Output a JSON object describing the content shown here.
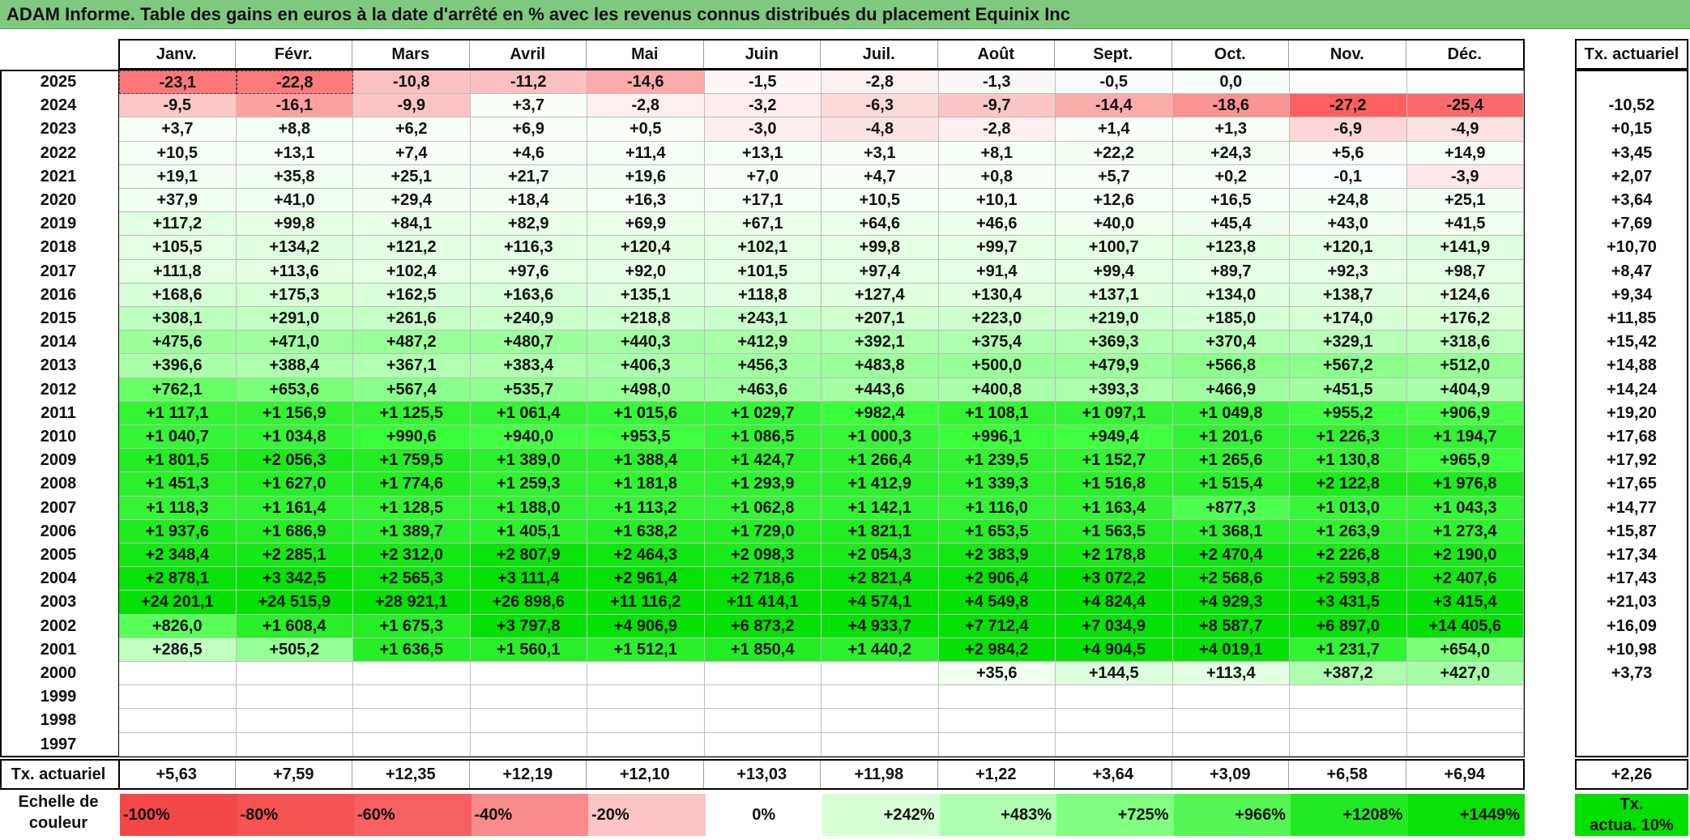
{
  "title": "ADAM Informe. Table des gains en euros à la date d'arrêté en % avec les revenus connus distribués du placement Equinix Inc",
  "months": [
    "Janv.",
    "Févr.",
    "Mars",
    "Avril",
    "Mai",
    "Juin",
    "Juil.",
    "Août",
    "Sept.",
    "Oct.",
    "Nov.",
    "Déc."
  ],
  "tx_header": "Tx. actuariel",
  "rows": [
    {
      "year": "2025",
      "values": [
        "-23,1",
        "-22,8",
        "-10,8",
        "-11,2",
        "-14,6",
        "-1,5",
        "-2,8",
        "-1,3",
        "-0,5",
        "0,0",
        "",
        ""
      ],
      "tx": ""
    },
    {
      "year": "2024",
      "values": [
        "-9,5",
        "-16,1",
        "-9,9",
        "+3,7",
        "-2,8",
        "-3,2",
        "-6,3",
        "-9,7",
        "-14,4",
        "-18,6",
        "-27,2",
        "-25,4"
      ],
      "tx": "-10,52"
    },
    {
      "year": "2023",
      "values": [
        "+3,7",
        "+8,8",
        "+6,2",
        "+6,9",
        "+0,5",
        "-3,0",
        "-4,8",
        "-2,8",
        "+1,4",
        "+1,3",
        "-6,9",
        "-4,9"
      ],
      "tx": "+0,15"
    },
    {
      "year": "2022",
      "values": [
        "+10,5",
        "+13,1",
        "+7,4",
        "+4,6",
        "+11,4",
        "+13,1",
        "+3,1",
        "+8,1",
        "+22,2",
        "+24,3",
        "+5,6",
        "+14,9"
      ],
      "tx": "+3,45"
    },
    {
      "year": "2021",
      "values": [
        "+19,1",
        "+35,8",
        "+25,1",
        "+21,7",
        "+19,6",
        "+7,0",
        "+4,7",
        "+0,8",
        "+5,7",
        "+0,2",
        "-0,1",
        "-3,9"
      ],
      "tx": "+2,07"
    },
    {
      "year": "2020",
      "values": [
        "+37,9",
        "+41,0",
        "+29,4",
        "+18,4",
        "+16,3",
        "+17,1",
        "+10,5",
        "+10,1",
        "+12,6",
        "+16,5",
        "+24,8",
        "+25,1"
      ],
      "tx": "+3,64"
    },
    {
      "year": "2019",
      "values": [
        "+117,2",
        "+99,8",
        "+84,1",
        "+82,9",
        "+69,9",
        "+67,1",
        "+64,6",
        "+46,6",
        "+40,0",
        "+45,4",
        "+43,0",
        "+41,5"
      ],
      "tx": "+7,69"
    },
    {
      "year": "2018",
      "values": [
        "+105,5",
        "+134,2",
        "+121,2",
        "+116,3",
        "+120,4",
        "+102,1",
        "+99,8",
        "+99,7",
        "+100,7",
        "+123,8",
        "+120,1",
        "+141,9"
      ],
      "tx": "+10,70"
    },
    {
      "year": "2017",
      "values": [
        "+111,8",
        "+113,6",
        "+102,4",
        "+97,6",
        "+92,0",
        "+101,5",
        "+97,4",
        "+91,4",
        "+99,4",
        "+89,7",
        "+92,3",
        "+98,7"
      ],
      "tx": "+8,47"
    },
    {
      "year": "2016",
      "values": [
        "+168,6",
        "+175,3",
        "+162,5",
        "+163,6",
        "+135,1",
        "+118,8",
        "+127,4",
        "+130,4",
        "+137,1",
        "+134,0",
        "+138,7",
        "+124,6"
      ],
      "tx": "+9,34"
    },
    {
      "year": "2015",
      "values": [
        "+308,1",
        "+291,0",
        "+261,6",
        "+240,9",
        "+218,8",
        "+243,1",
        "+207,1",
        "+223,0",
        "+219,0",
        "+185,0",
        "+174,0",
        "+176,2"
      ],
      "tx": "+11,85"
    },
    {
      "year": "2014",
      "values": [
        "+475,6",
        "+471,0",
        "+487,2",
        "+480,7",
        "+440,3",
        "+412,9",
        "+392,1",
        "+375,4",
        "+369,3",
        "+370,4",
        "+329,1",
        "+318,6"
      ],
      "tx": "+15,42"
    },
    {
      "year": "2013",
      "values": [
        "+396,6",
        "+388,4",
        "+367,1",
        "+383,4",
        "+406,3",
        "+456,3",
        "+483,8",
        "+500,0",
        "+479,9",
        "+566,8",
        "+567,2",
        "+512,0"
      ],
      "tx": "+14,88"
    },
    {
      "year": "2012",
      "values": [
        "+762,1",
        "+653,6",
        "+567,4",
        "+535,7",
        "+498,0",
        "+463,6",
        "+443,6",
        "+400,8",
        "+393,3",
        "+466,9",
        "+451,5",
        "+404,9"
      ],
      "tx": "+14,24"
    },
    {
      "year": "2011",
      "values": [
        "+1 117,1",
        "+1 156,9",
        "+1 125,5",
        "+1 061,4",
        "+1 015,6",
        "+1 029,7",
        "+982,4",
        "+1 108,1",
        "+1 097,1",
        "+1 049,8",
        "+955,2",
        "+906,9"
      ],
      "tx": "+19,20"
    },
    {
      "year": "2010",
      "values": [
        "+1 040,7",
        "+1 034,8",
        "+990,6",
        "+940,0",
        "+953,5",
        "+1 086,5",
        "+1 000,3",
        "+996,1",
        "+949,4",
        "+1 201,6",
        "+1 226,3",
        "+1 194,7"
      ],
      "tx": "+17,68"
    },
    {
      "year": "2009",
      "values": [
        "+1 801,5",
        "+2 056,3",
        "+1 759,5",
        "+1 389,0",
        "+1 388,4",
        "+1 424,7",
        "+1 266,4",
        "+1 239,5",
        "+1 152,7",
        "+1 265,6",
        "+1 130,8",
        "+965,9"
      ],
      "tx": "+17,92"
    },
    {
      "year": "2008",
      "values": [
        "+1 451,3",
        "+1 627,0",
        "+1 774,6",
        "+1 259,3",
        "+1 181,8",
        "+1 293,9",
        "+1 412,9",
        "+1 339,3",
        "+1 516,8",
        "+1 515,4",
        "+2 122,8",
        "+1 976,8"
      ],
      "tx": "+17,65"
    },
    {
      "year": "2007",
      "values": [
        "+1 118,3",
        "+1 161,4",
        "+1 128,5",
        "+1 188,0",
        "+1 113,2",
        "+1 062,8",
        "+1 142,1",
        "+1 116,0",
        "+1 163,4",
        "+877,3",
        "+1 013,0",
        "+1 043,3"
      ],
      "tx": "+14,77"
    },
    {
      "year": "2006",
      "values": [
        "+1 937,6",
        "+1 686,9",
        "+1 389,7",
        "+1 405,1",
        "+1 638,2",
        "+1 729,0",
        "+1 821,1",
        "+1 653,5",
        "+1 563,5",
        "+1 368,1",
        "+1 263,9",
        "+1 273,4"
      ],
      "tx": "+15,87"
    },
    {
      "year": "2005",
      "values": [
        "+2 348,4",
        "+2 285,1",
        "+2 312,0",
        "+2 807,9",
        "+2 464,3",
        "+2 098,3",
        "+2 054,3",
        "+2 383,9",
        "+2 178,8",
        "+2 470,4",
        "+2 226,8",
        "+2 190,0"
      ],
      "tx": "+17,34"
    },
    {
      "year": "2004",
      "values": [
        "+2 878,1",
        "+3 342,5",
        "+2 565,3",
        "+3 111,4",
        "+2 961,4",
        "+2 718,6",
        "+2 821,4",
        "+2 906,4",
        "+3 072,2",
        "+2 568,6",
        "+2 593,8",
        "+2 407,6"
      ],
      "tx": "+17,43"
    },
    {
      "year": "2003",
      "values": [
        "+24 201,1",
        "+24 515,9",
        "+28 921,1",
        "+26 898,6",
        "+11 116,2",
        "+11 414,1",
        "+4 574,1",
        "+4 549,8",
        "+4 824,4",
        "+4 929,3",
        "+3 431,5",
        "+3 415,4"
      ],
      "tx": "+21,03"
    },
    {
      "year": "2002",
      "values": [
        "+826,0",
        "+1 608,4",
        "+1 675,3",
        "+3 797,8",
        "+4 906,9",
        "+6 873,2",
        "+4 933,7",
        "+7 712,4",
        "+7 034,9",
        "+8 587,7",
        "+6 897,0",
        "+14 405,6"
      ],
      "tx": "+16,09"
    },
    {
      "year": "2001",
      "values": [
        "+286,5",
        "+505,2",
        "+1 636,5",
        "+1 560,1",
        "+1 512,1",
        "+1 850,4",
        "+1 440,2",
        "+2 984,2",
        "+4 904,5",
        "+4 019,1",
        "+1 231,7",
        "+654,0"
      ],
      "tx": "+10,98"
    },
    {
      "year": "2000",
      "values": [
        "",
        "",
        "",
        "",
        "",
        "",
        "",
        "+35,6",
        "+144,5",
        "+113,4",
        "+387,2",
        "+427,0"
      ],
      "tx": "+3,73"
    },
    {
      "year": "1999",
      "values": [
        "",
        "",
        "",
        "",
        "",
        "",
        "",
        "",
        "",
        "",
        "",
        ""
      ],
      "tx": ""
    },
    {
      "year": "1998",
      "values": [
        "",
        "",
        "",
        "",
        "",
        "",
        "",
        "",
        "",
        "",
        "",
        ""
      ],
      "tx": ""
    },
    {
      "year": "1997",
      "values": [
        "",
        "",
        "",
        "",
        "",
        "",
        "",
        "",
        "",
        "",
        "",
        ""
      ],
      "tx": ""
    }
  ],
  "footer": {
    "label": "Tx. actuariel",
    "values": [
      "+5,63",
      "+7,59",
      "+12,35",
      "+12,19",
      "+12,10",
      "+13,03",
      "+11,98",
      "+1,22",
      "+3,64",
      "+3,09",
      "+6,58",
      "+6,94"
    ],
    "total": "+2,26"
  },
  "scale": {
    "label_line1": "Echelle de",
    "label_line2": "couleur",
    "items": [
      {
        "label": "-100%",
        "color": "#f44848",
        "align": "left"
      },
      {
        "label": "-80%",
        "color": "#f55252",
        "align": "left"
      },
      {
        "label": "-60%",
        "color": "#f76060",
        "align": "left"
      },
      {
        "label": "-40%",
        "color": "#f98a8a",
        "align": "left"
      },
      {
        "label": "-20%",
        "color": "#fcc4c4",
        "align": "left"
      },
      {
        "label": "0%",
        "color": "#ffffff",
        "align": "center"
      },
      {
        "label": "+242%",
        "color": "#d6ffd6",
        "align": "right"
      },
      {
        "label": "+483%",
        "color": "#b0ffb0",
        "align": "right"
      },
      {
        "label": "+725%",
        "color": "#80ff80",
        "align": "right"
      },
      {
        "label": "+966%",
        "color": "#55f555",
        "align": "right"
      },
      {
        "label": "+1208%",
        "color": "#22ea22",
        "align": "right"
      },
      {
        "label": "+1449%",
        "color": "#08e008",
        "align": "right"
      }
    ],
    "badge_line1": "Tx.",
    "badge_line2": "actua. 10%",
    "badge_color": "#00e000"
  },
  "colors": {
    "title_bg": "#7fc97f",
    "negative": "#f44848",
    "positive": "#00e000"
  }
}
